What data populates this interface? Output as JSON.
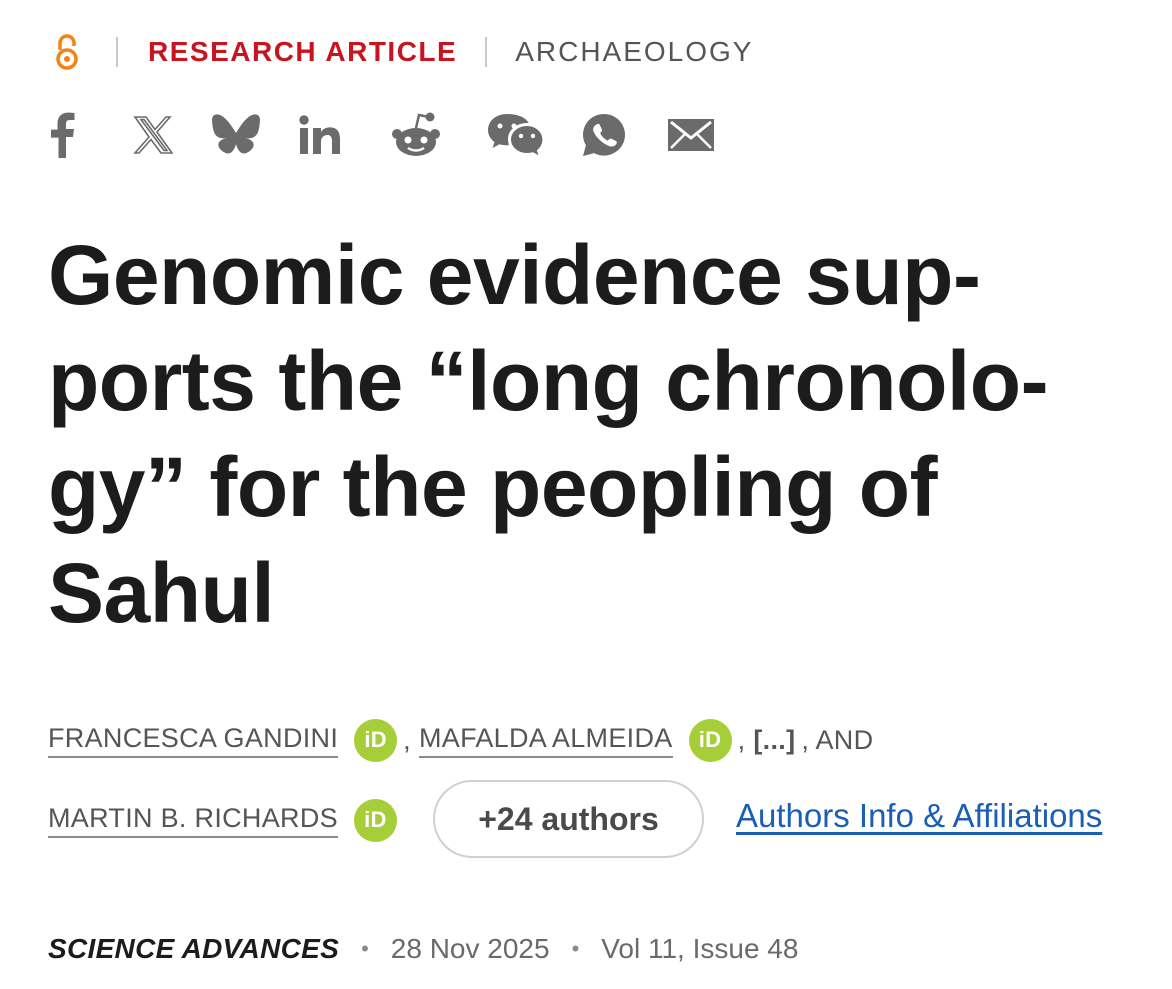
{
  "meta": {
    "access_icon": "open-access-icon",
    "article_type": "RESEARCH ARTICLE",
    "subject": "ARCHAEOLOGY",
    "accent_color": "#c8141e"
  },
  "share": [
    {
      "icon": "facebook-icon"
    },
    {
      "icon": "x-icon"
    },
    {
      "icon": "bluesky-icon"
    },
    {
      "icon": "linkedin-icon"
    },
    {
      "icon": "reddit-icon"
    },
    {
      "icon": "wechat-icon"
    },
    {
      "icon": "whatsapp-icon"
    },
    {
      "icon": "email-icon"
    }
  ],
  "title_lines": [
    "Genomic evidence sup-",
    "ports the “long chronolo-",
    "gy” for the peopling of",
    "Sahul"
  ],
  "authors": {
    "first": "FRANCESCA GANDINI",
    "second": "MAFALDA ALMEIDA",
    "comma": ",",
    "ellipsis": "[...]",
    "and": ", AND",
    "last": "MARTIN B. RICHARDS",
    "orcid_label": "iD",
    "orcid_color": "#a6ce39",
    "more_button": "+24 authors",
    "affiliations_link": "Authors Info & Affiliations",
    "link_color": "#1a5fb4"
  },
  "journal": {
    "name": "SCIENCE ADVANCES",
    "separator": "•",
    "date": "28 Nov 2025",
    "volume_issue": "Vol 11, Issue 48"
  }
}
